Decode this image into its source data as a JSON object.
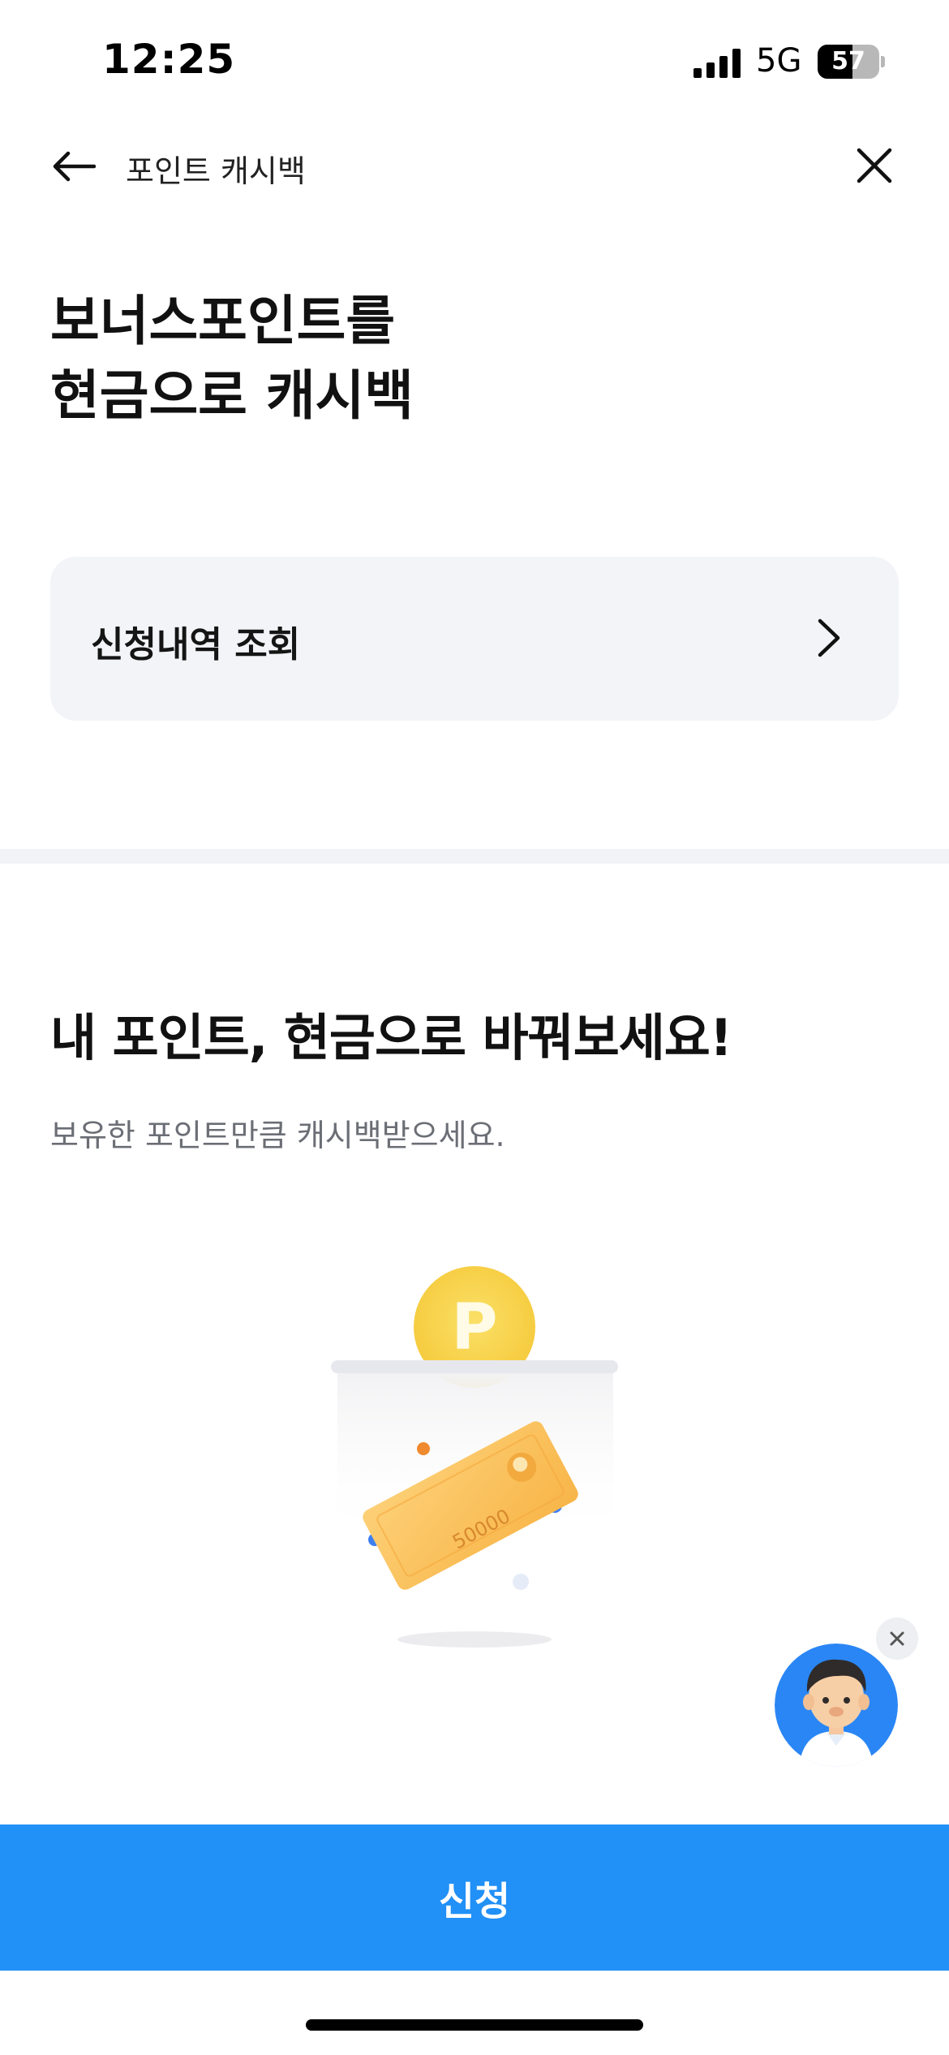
{
  "status_bar": {
    "time": "12:25",
    "network": "5G",
    "battery": "57",
    "battery_level_percent": 57
  },
  "nav": {
    "title": "포인트 캐시백",
    "back_icon": "arrow-left-icon",
    "close_icon": "close-icon"
  },
  "hero": {
    "title_line1": "보너스포인트를",
    "title_line2": "현금으로 캐시백"
  },
  "history_card": {
    "label": "신청내역 조회",
    "icon": "chevron-right-icon"
  },
  "promo": {
    "title": "내 포인트, 현금으로 바꿔보세요!",
    "subtitle": "보유한 포인트만큼 캐시백받으세요."
  },
  "illustration": {
    "coin_letter": "P",
    "bill_amount": "50000"
  },
  "chatbot": {
    "avatar_icon": "chatbot-avatar-icon",
    "close_icon": "close-icon"
  },
  "apply_button": {
    "label": "신청"
  },
  "colors": {
    "accent": "#2190f7",
    "card_bg": "#f3f4f8",
    "coin": "#f8d347",
    "bill": "#fbc15a"
  }
}
